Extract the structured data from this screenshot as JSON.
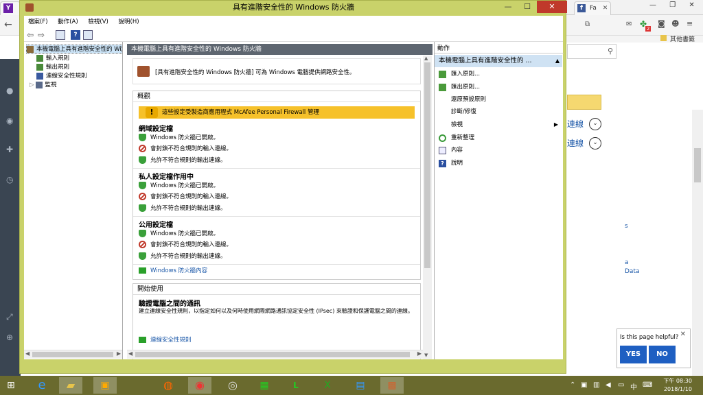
{
  "window": {
    "title": "具有進階安全性的 Windows 防火牆",
    "minimize": "—",
    "maximize": "☐",
    "close": "✕"
  },
  "menu": [
    "檔案(F)",
    "動作(A)",
    "檢視(V)",
    "說明(H)"
  ],
  "tree": {
    "root": "本機電腦上具有進階安全性的 Windows 防火牆",
    "items": [
      "輸入規則",
      "輸出規則",
      "連線安全性規則",
      "監視"
    ]
  },
  "center": {
    "header": "本機電腦上具有進階安全性的 Windows 防火牆",
    "intro": "[具有進階安全性的 Windows 防火牆] 可為 Windows 電腦提供網路安全性。",
    "overview": {
      "title": "概觀",
      "warning": "這些設定受製造商應用程式 McAfee  Personal Firewall 管理",
      "profiles": [
        {
          "name": "網域設定檔",
          "lines": [
            "Windows 防火牆已開啟。",
            "會封鎖不符合規則的輸入連線。",
            "允許不符合規則的輸出連線。"
          ]
        },
        {
          "name": "私人設定檔作用中",
          "lines": [
            "Windows 防火牆已開啟。",
            "會封鎖不符合規則的輸入連線。",
            "允許不符合規則的輸出連線。"
          ]
        },
        {
          "name": "公用設定檔",
          "lines": [
            "Windows 防火牆已開啟。",
            "會封鎖不符合規則的輸入連線。",
            "允許不符合規則的輸出連線。"
          ]
        }
      ],
      "link": "Windows 防火牆內容"
    },
    "getting_started": {
      "title": "開始使用",
      "heading": "驗證電腦之間的通訊",
      "desc": "建立連線安全性規則，以指定如何以及何時使用網際網路通訊協定安全性 (IPsec) 來驗證和保護電腦之間的連線。",
      "link": "連線安全性規則"
    }
  },
  "actions": {
    "header": "動作",
    "selected": "本機電腦上具有進階安全性的 ...",
    "items": [
      "匯入原則...",
      "匯出原則...",
      "還原預設原則",
      "診斷/修復",
      "檢視",
      "重新整理",
      "內容",
      "說明"
    ]
  },
  "browser": {
    "tab1": "Fa",
    "bookmark": "其他書籤",
    "badge": "2",
    "conn1": "連線",
    "conn2": "連線",
    "frag1": "s",
    "frag2": "a",
    "frag3": "Data",
    "feedback_q": "Is this page helpful?",
    "yes": "YES",
    "no": "NO"
  },
  "taskbar": {
    "ime": "中",
    "time": "下午 08:30",
    "date": "2018/1/10"
  }
}
